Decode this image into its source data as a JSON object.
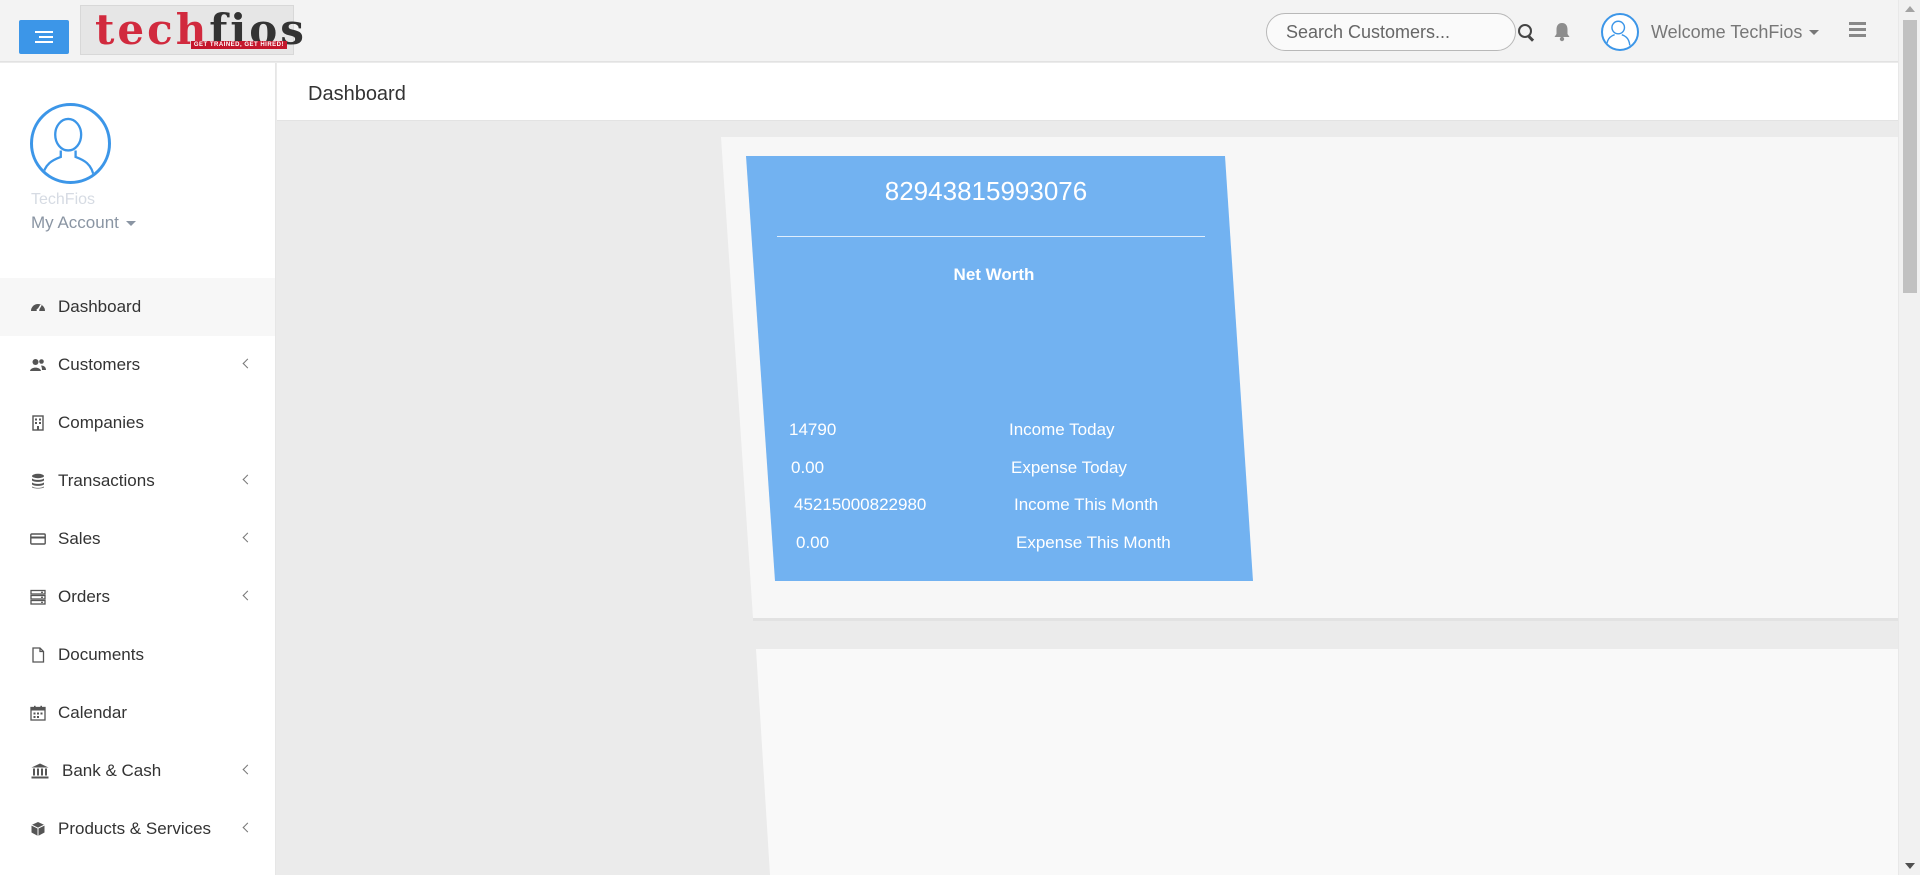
{
  "topbar": {
    "logo_text_main": "tech",
    "logo_text_accent": "fios",
    "logo_tagline": "GET TRAINED, GET HIRED!",
    "search_placeholder": "Search Customers...",
    "welcome": "Welcome TechFios"
  },
  "sidebar": {
    "profile_name": "TechFios",
    "my_account": "My Account",
    "items": [
      {
        "label": "Dashboard",
        "icon": "dashboard-icon",
        "has_children": false
      },
      {
        "label": "Customers",
        "icon": "users-icon",
        "has_children": true
      },
      {
        "label": "Companies",
        "icon": "building-icon",
        "has_children": false
      },
      {
        "label": "Transactions",
        "icon": "database-icon",
        "has_children": true
      },
      {
        "label": "Sales",
        "icon": "credit-card-icon",
        "has_children": true
      },
      {
        "label": "Orders",
        "icon": "server-icon",
        "has_children": true
      },
      {
        "label": "Documents",
        "icon": "file-icon",
        "has_children": false
      },
      {
        "label": "Calendar",
        "icon": "calendar-icon",
        "has_children": false
      },
      {
        "label": "Bank & Cash",
        "icon": "bank-icon",
        "has_children": true
      },
      {
        "label": "Products & Services",
        "icon": "cube-icon",
        "has_children": true
      }
    ]
  },
  "main": {
    "page_title": "Dashboard",
    "stats": {
      "net_worth_value": "82943815993076",
      "net_worth_label": "Net Worth",
      "rows": [
        {
          "value": "14790",
          "label": "Income Today"
        },
        {
          "value": "0.00",
          "label": "Expense Today"
        },
        {
          "value": "45215000822980",
          "label": "Income This Month"
        },
        {
          "value": "0.00",
          "label": "Expense This Month"
        }
      ]
    }
  },
  "colors": {
    "accent": "#3c96e8",
    "card": "#72b2f1",
    "panel": "#f7f7f7"
  }
}
